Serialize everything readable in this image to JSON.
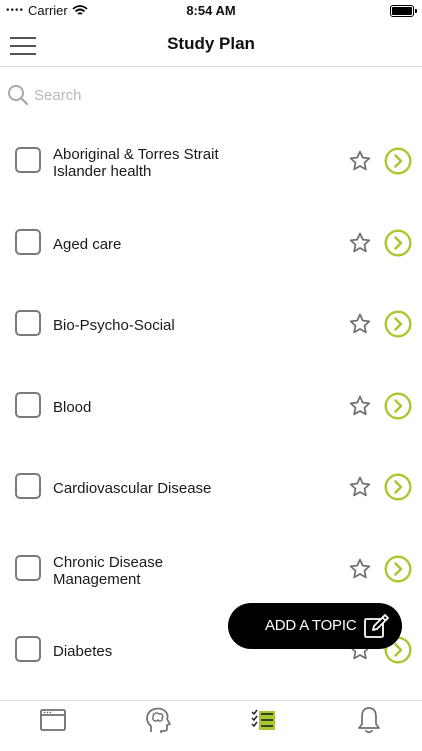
{
  "status_bar": {
    "carrier": "Carrier",
    "signal_dots": "••••",
    "time": "8:54 AM"
  },
  "nav": {
    "title": "Study Plan"
  },
  "search": {
    "placeholder": "Search"
  },
  "topics": [
    {
      "line1": "Aboriginal & Torres Strait",
      "line2": "Islander health"
    },
    {
      "line1": "Aged care",
      "line2": ""
    },
    {
      "line1": "Bio-Psycho-Social",
      "line2": ""
    },
    {
      "line1": "Blood",
      "line2": ""
    },
    {
      "line1": "Cardiovascular Disease",
      "line2": ""
    },
    {
      "line1": "Chronic Disease",
      "line2": "Management"
    },
    {
      "line1": "Diabetes",
      "line2": ""
    }
  ],
  "add_topic": {
    "label": "ADD A TOPIC"
  },
  "colors": {
    "accent_green": "#a6c930",
    "icon_gray": "#6e6e6e",
    "pill_black": "#000000"
  },
  "tabbar": {
    "tabs": [
      "browser-icon",
      "brain-head-icon",
      "checklist-icon",
      "bell-icon"
    ],
    "active": "checklist-icon"
  }
}
